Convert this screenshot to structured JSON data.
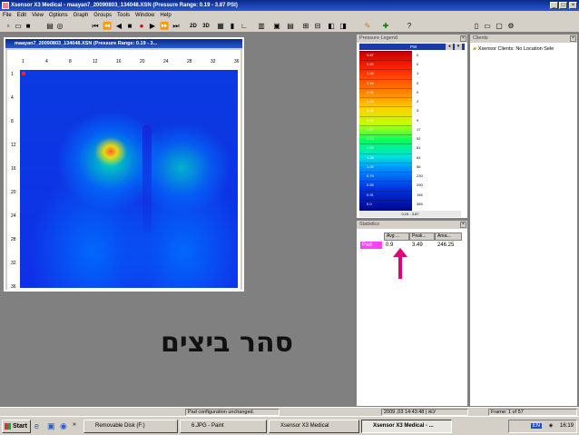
{
  "app": {
    "title": "Xsensor X3 Medical - maayan7_20090803_134048.XSN  (Pressure Range: 0.19 - 3.87 PSI)"
  },
  "menu": [
    "File",
    "Edit",
    "View",
    "Options",
    "Graph",
    "Groups",
    "Tools",
    "Window",
    "Help"
  ],
  "toolbar": {
    "btn_2d": "2D",
    "btn_3d": "3D"
  },
  "map_window": {
    "title": "maayan7_20090803_134048.XSN  (Pressure Range: 0.19 - 3...",
    "x_ticks": [
      "1",
      "4",
      "8",
      "12",
      "16",
      "20",
      "24",
      "28",
      "32",
      "36"
    ],
    "y_ticks": [
      "1",
      "4",
      "8",
      "12",
      "16",
      "20",
      "24",
      "28",
      "32",
      "36"
    ]
  },
  "caption": "סהר ביצים",
  "legend": {
    "title": "Pressure Legend",
    "unit": "PSI",
    "left_values": [
      "3.87",
      "3.65",
      "3.34",
      "3.16",
      "2.92",
      "2.68",
      "2.45",
      "2.21",
      "1.97",
      "1.73",
      "1.50",
      "1.26",
      "1.02",
      "0.79",
      "0.55",
      "0.31",
      "0.0"
    ],
    "right_values": [
      "0",
      "0",
      "1",
      "0",
      "0",
      "2",
      "3",
      "9",
      "17",
      "52",
      "81",
      "64",
      "56",
      "230",
      "290",
      "156",
      "385"
    ],
    "range_text": "0.19 - 3.87"
  },
  "statistics": {
    "title": "Statistics",
    "columns": [
      "Avg ...",
      "Peak...",
      "Area..."
    ],
    "row": {
      "label": "Pad",
      "avg": "0.9",
      "peak": "3.49",
      "area": "246.25"
    }
  },
  "clients": {
    "title": "Clients",
    "item": "Xsensor Clients: No Location Sele"
  },
  "status": {
    "message": "Pad configuration unchanged.",
    "datetime": "2009 ,03 ינוא | 14:43:48",
    "frame": "Frame: 1 of 57"
  },
  "taskbar": {
    "start": "Start",
    "tasks": [
      "Removable Disk (F:)",
      "6.JPG - Paint",
      "Xsensor X3 Medical",
      "Xsensor X3 Medical - ..."
    ],
    "lang": "EN",
    "clock": "16:19"
  },
  "colors": {
    "title_blue": "#0a2a8a",
    "arrow": "#e0007a",
    "pad_label": "#ff40ff"
  }
}
